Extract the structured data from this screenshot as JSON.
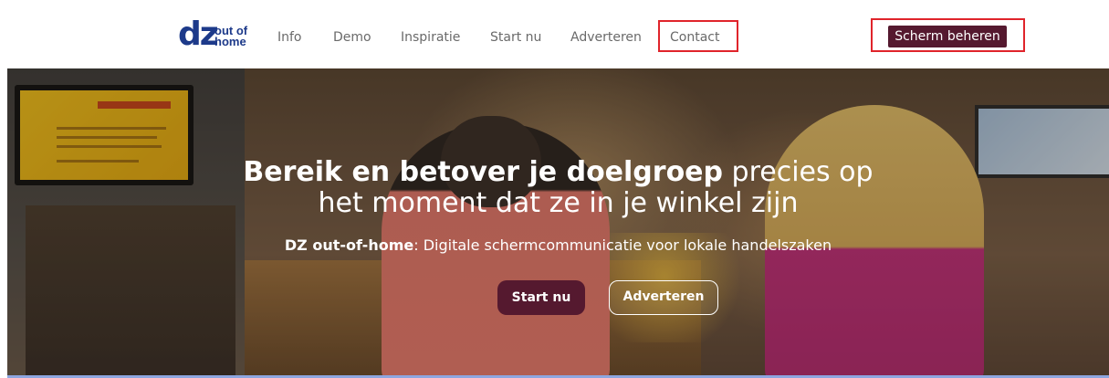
{
  "header": {
    "logo": {
      "main": "dz",
      "sub_top": "out of",
      "sub_bottom": "home",
      "color": "#1d3a8a"
    },
    "nav": [
      {
        "label": "Info"
      },
      {
        "label": "Demo"
      },
      {
        "label": "Inspiratie"
      },
      {
        "label": "Start nu"
      },
      {
        "label": "Adverteren"
      },
      {
        "label": "Contact"
      }
    ],
    "manage_button": "Scherm beheren"
  },
  "hero": {
    "title_bold": "Bereik en betover je doelgroep",
    "title_rest": " precies op",
    "title_line2": "het moment dat ze in je winkel zijn",
    "subtitle_bold": "DZ out-of-home",
    "subtitle_rest": ": Digitale schermcommunicatie voor lokale handelszaken",
    "btn_start": "Start nu",
    "btn_adv": "Adverteren"
  },
  "colors": {
    "brand_primary": "#55192f",
    "logo_blue": "#1d3a8a",
    "highlight": "#e0242b",
    "nav_text": "#6a6a6a"
  }
}
